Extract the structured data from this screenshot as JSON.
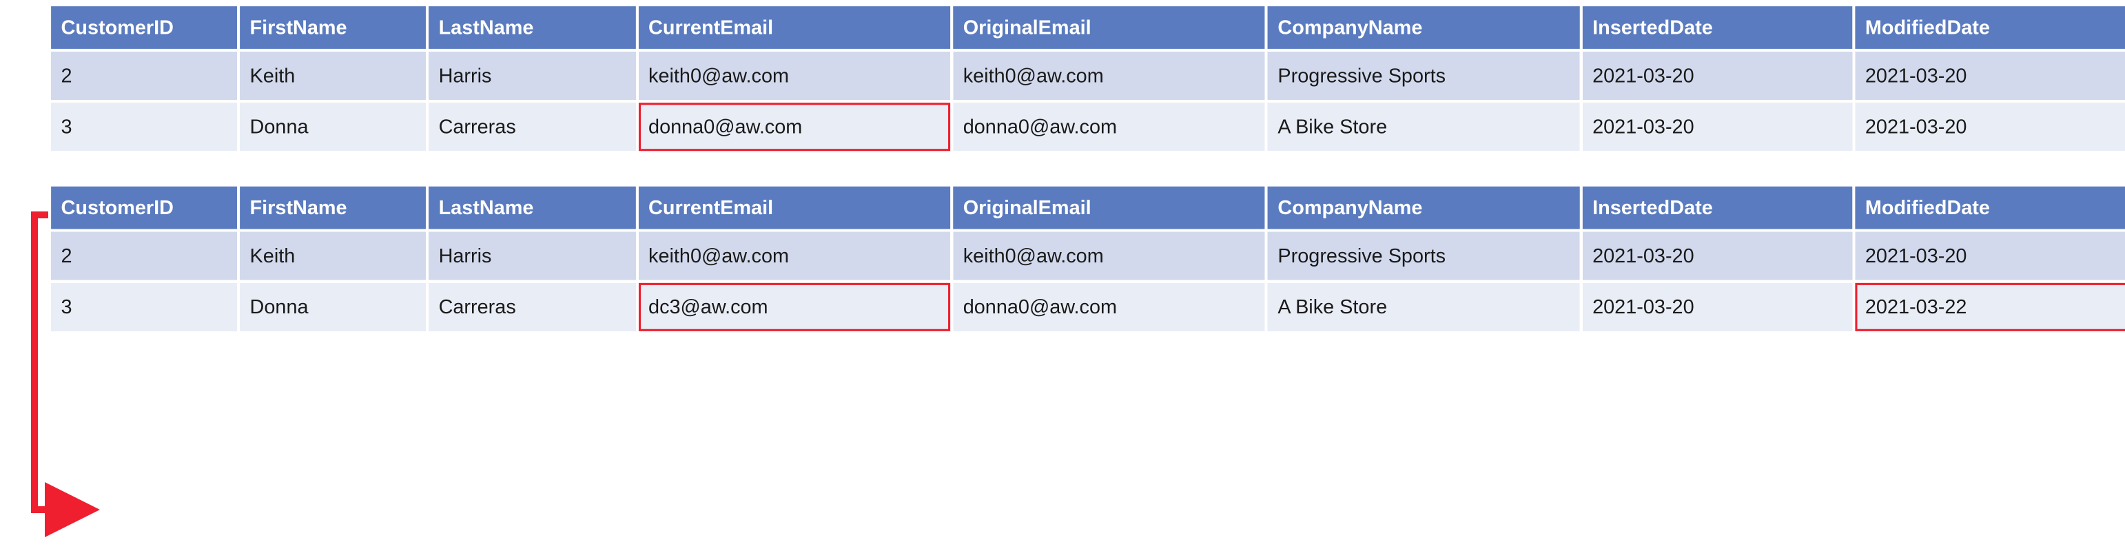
{
  "headers": {
    "customerId": "CustomerID",
    "firstName": "FirstName",
    "lastName": "LastName",
    "currentEmail": "CurrentEmail",
    "originalEmail": "OriginalEmail",
    "companyName": "CompanyName",
    "insertedDate": "InsertedDate",
    "modifiedDate": "ModifiedDate"
  },
  "tables": [
    {
      "rows": [
        {
          "customerId": "2",
          "firstName": "Keith",
          "lastName": "Harris",
          "currentEmail": "keith0@aw.com",
          "originalEmail": "keith0@aw.com",
          "companyName": "Progressive Sports",
          "insertedDate": "2021-03-20",
          "modifiedDate": "2021-03-20",
          "highlightCurrentEmail": false,
          "highlightModifiedDate": false
        },
        {
          "customerId": "3",
          "firstName": "Donna",
          "lastName": "Carreras",
          "currentEmail": "donna0@aw.com",
          "originalEmail": "donna0@aw.com",
          "companyName": "A Bike Store",
          "insertedDate": "2021-03-20",
          "modifiedDate": "2021-03-20",
          "highlightCurrentEmail": true,
          "highlightModifiedDate": false
        }
      ]
    },
    {
      "rows": [
        {
          "customerId": "2",
          "firstName": "Keith",
          "lastName": "Harris",
          "currentEmail": "keith0@aw.com",
          "originalEmail": "keith0@aw.com",
          "companyName": "Progressive Sports",
          "insertedDate": "2021-03-20",
          "modifiedDate": "2021-03-20",
          "highlightCurrentEmail": false,
          "highlightModifiedDate": false
        },
        {
          "customerId": "3",
          "firstName": "Donna",
          "lastName": "Carreras",
          "currentEmail": "dc3@aw.com",
          "originalEmail": "donna0@aw.com",
          "companyName": "A Bike Store",
          "insertedDate": "2021-03-20",
          "modifiedDate": "2021-03-22",
          "highlightCurrentEmail": true,
          "highlightModifiedDate": true
        }
      ]
    }
  ],
  "colors": {
    "headerBg": "#5a7bbf",
    "rowOdd": "#d2d9ec",
    "rowEven": "#e9edf6",
    "highlight": "#ef1f2f",
    "arrow": "#ef1f2f"
  }
}
